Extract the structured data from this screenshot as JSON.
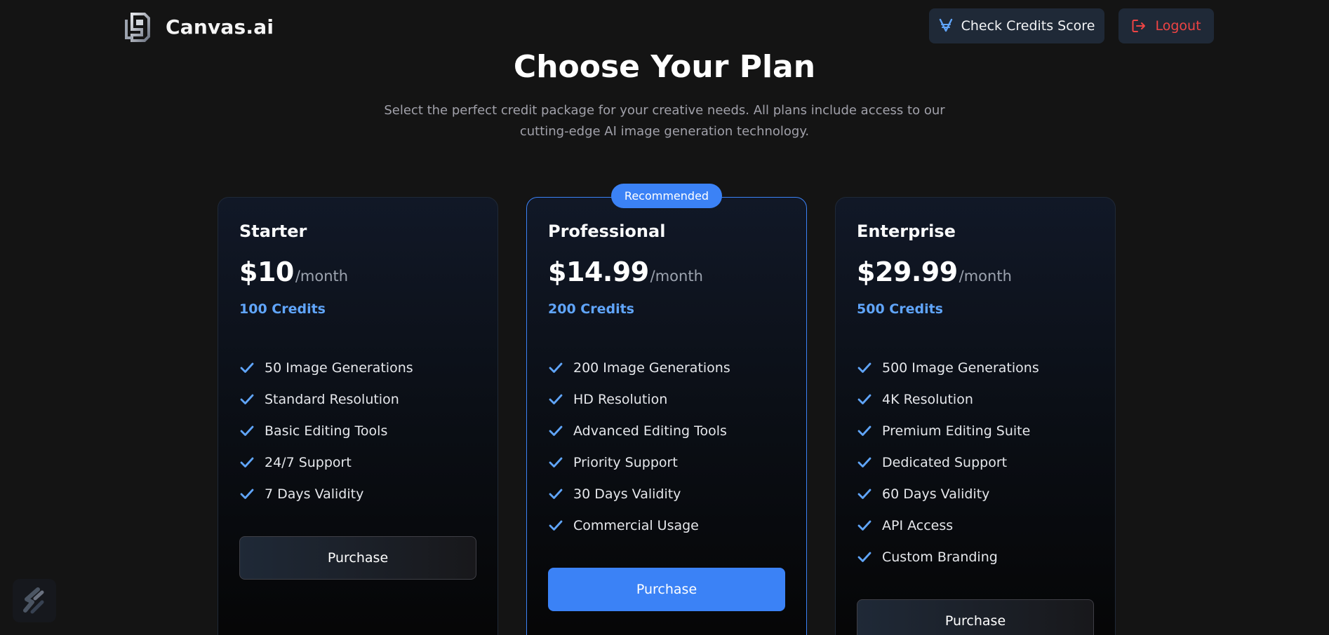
{
  "header": {
    "brand_name": "Canvas.ai",
    "credits_button_label": "Check Credits Score",
    "logout_button_label": "Logout"
  },
  "hero": {
    "title": "Choose Your Plan",
    "subtitle": "Select the perfect credit package for your creative needs. All plans include access to our cutting-edge AI image generation technology."
  },
  "plans": [
    {
      "name": "Starter",
      "price": "$10",
      "period": "/month",
      "credits": "100 Credits",
      "features": [
        "50 Image Generations",
        "Standard Resolution",
        "Basic Editing Tools",
        "24/7 Support",
        "7 Days Validity"
      ],
      "button_label": "Purchase"
    },
    {
      "name": "Professional",
      "badge": "Recommended",
      "price": "$14.99",
      "period": "/month",
      "credits": "200 Credits",
      "features": [
        "200 Image Generations",
        "HD Resolution",
        "Advanced Editing Tools",
        "Priority Support",
        "30 Days Validity",
        "Commercial Usage"
      ],
      "button_label": "Purchase"
    },
    {
      "name": "Enterprise",
      "price": "$29.99",
      "period": "/month",
      "credits": "500 Credits",
      "features": [
        "500 Image Generations",
        "4K Resolution",
        "Premium Editing Suite",
        "Dedicated Support",
        "60 Days Validity",
        "API Access",
        "Custom Branding"
      ],
      "button_label": "Purchase"
    }
  ],
  "colors": {
    "accent": "#3b82f6",
    "credits_text": "#60a5fa",
    "logout": "#ef4444",
    "background": "#141414"
  },
  "icons": {
    "brand": "canvas-logo-icon",
    "credits": "v-currency-icon",
    "logout": "logout-icon",
    "feature": "check-icon",
    "corner": "slash-logo-icon"
  }
}
